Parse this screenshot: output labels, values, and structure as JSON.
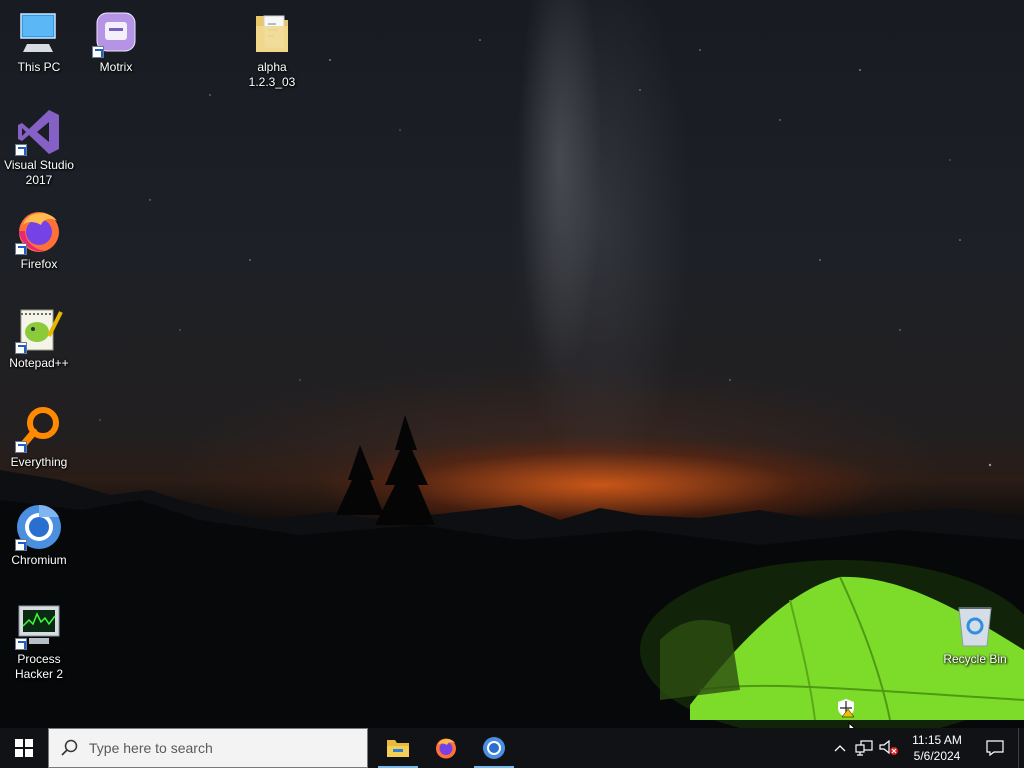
{
  "desktop": {
    "icons": [
      {
        "label": "This PC",
        "icon": "this-pc-icon"
      },
      {
        "label": "Motrix",
        "icon": "motrix-icon"
      },
      {
        "label": "alpha 1.2.3_03",
        "icon": "folder-icon"
      },
      {
        "label": "Visual Studio 2017",
        "icon": "visual-studio-icon"
      },
      {
        "label": "Firefox",
        "icon": "firefox-icon"
      },
      {
        "label": "Notepad++",
        "icon": "notepadpp-icon"
      },
      {
        "label": "Everything",
        "icon": "everything-icon"
      },
      {
        "label": "Chromium",
        "icon": "chromium-icon"
      },
      {
        "label": "Process Hacker 2",
        "icon": "process-hacker-icon"
      },
      {
        "label": "Recycle Bin",
        "icon": "recycle-bin-icon"
      }
    ]
  },
  "taskbar": {
    "search_placeholder": "Type here to search",
    "pinned": [
      {
        "name": "File Explorer",
        "icon": "file-explorer-icon",
        "active": true
      },
      {
        "name": "Firefox",
        "icon": "firefox-icon",
        "active": false
      },
      {
        "name": "Chromium",
        "icon": "chromium-icon",
        "active": true
      }
    ],
    "clock": {
      "time": "11:15 AM",
      "date": "5/6/2024"
    },
    "tray_icons": [
      "chevron-up-icon",
      "network-icon",
      "volume-muted-icon",
      "notification-icon"
    ]
  },
  "colors": {
    "taskbar": "#101215",
    "accent": "#76b9ed",
    "tent": "#7ddc2a"
  }
}
